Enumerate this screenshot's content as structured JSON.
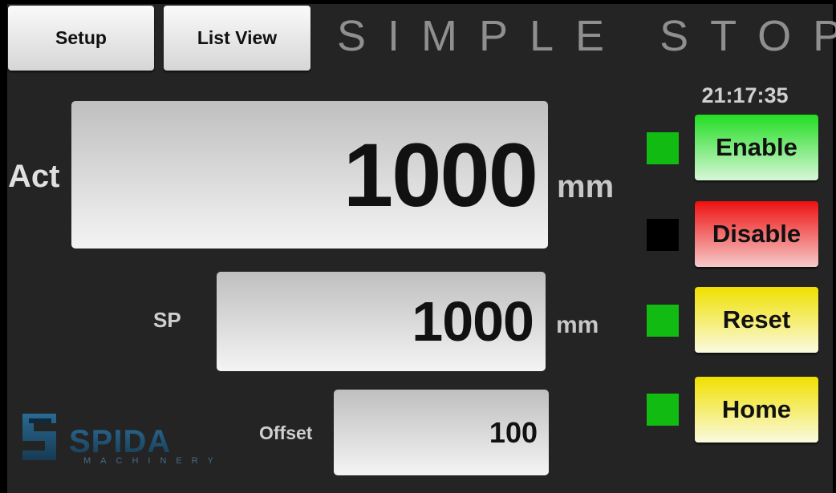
{
  "toolbar": {
    "setup_label": "Setup",
    "list_view_label": "List View"
  },
  "title": "SIMPLE STOP",
  "clock": "21:17:35",
  "act": {
    "label": "Act",
    "value": "1000",
    "unit": "mm"
  },
  "sp": {
    "label": "SP",
    "value": "1000",
    "unit": "mm"
  },
  "offset": {
    "label": "Offset",
    "value": "100"
  },
  "controls": [
    {
      "label": "Enable",
      "indicator_color": "#11bb11"
    },
    {
      "label": "Disable",
      "indicator_color": "#000000"
    },
    {
      "label": "Reset",
      "indicator_color": "#11bb11"
    },
    {
      "label": "Home",
      "indicator_color": "#11bb11"
    }
  ],
  "logo": {
    "name": "SPIDA",
    "subtitle": "MACHINERY",
    "icon": "spida-logo-icon"
  },
  "colors": {
    "background": "#242424",
    "indicator_on": "#11bb11",
    "indicator_off": "#000000",
    "enable": "#22dd22",
    "disable": "#ee1111",
    "reset_home": "#f0e000",
    "logo_blue": "#1f4f6e"
  }
}
